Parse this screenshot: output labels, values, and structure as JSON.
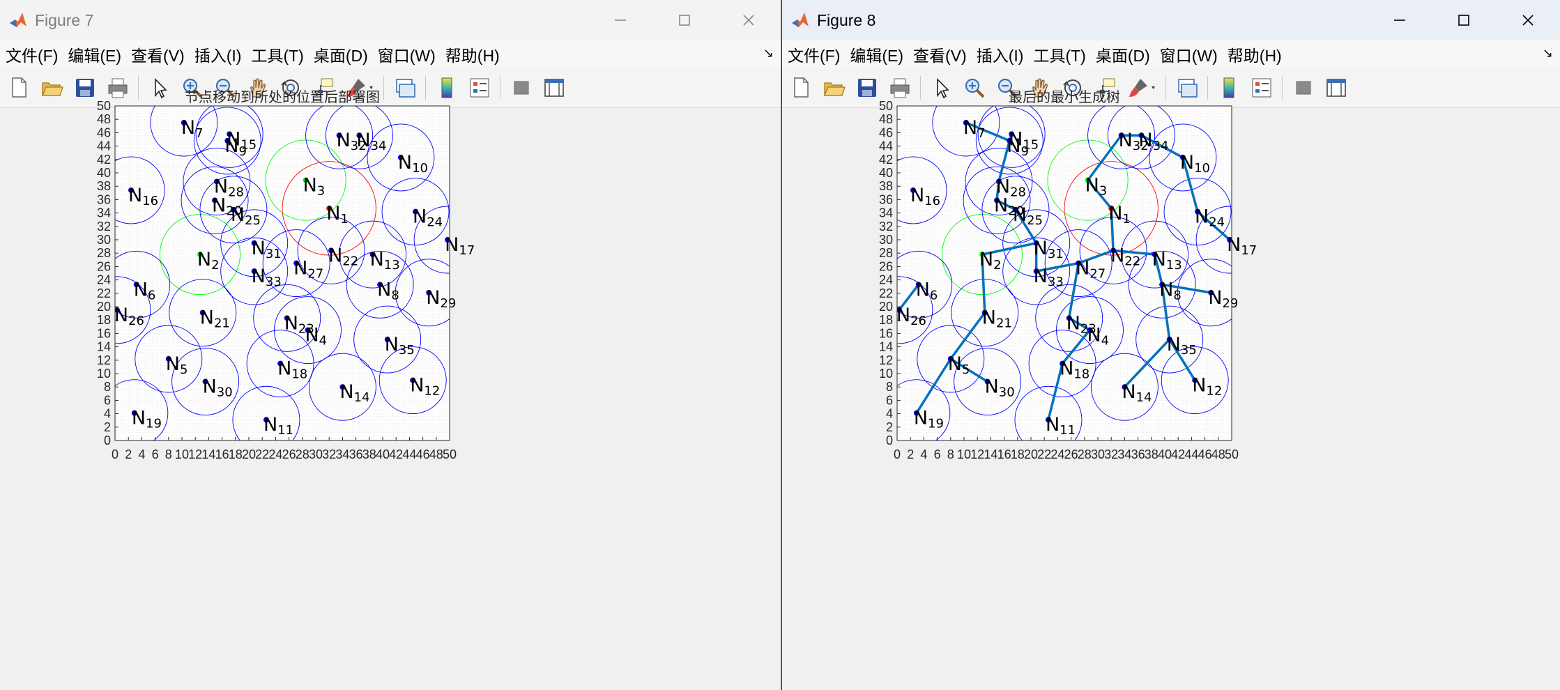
{
  "left_window": {
    "title": "Figure 7",
    "plot_title": "节点移动到所处的位置后部署图",
    "show_mst": false
  },
  "right_window": {
    "title": "Figure 8",
    "plot_title": "最后的最小生成树",
    "show_mst": true
  },
  "menu": [
    "文件(F)",
    "编辑(E)",
    "查看(V)",
    "插入(I)",
    "工具(T)",
    "桌面(D)",
    "窗口(W)",
    "帮助(H)"
  ],
  "menu_overflow": "↘",
  "toolbar_icons": [
    "new-figure-icon",
    "open-file-icon",
    "save-icon",
    "print-icon",
    "pointer-icon",
    "zoom-in-icon",
    "zoom-out-icon",
    "pan-hand-icon",
    "rotate-3d-icon",
    "data-cursor-icon",
    "brush-icon",
    "link-plot-icon",
    "colorbar-icon",
    "legend-icon",
    "hide-plot-tools-icon",
    "show-plot-tools-icon"
  ],
  "colors": {
    "axes_bg": "#ffffff",
    "grid": "#e2e2e2",
    "node": "#0000ff",
    "circle": "#0000ff",
    "sink_node": "#ff0000",
    "special_node": "#00ff00",
    "mst_edge": "#0072bd",
    "node_label": "#000000"
  },
  "chart_data": {
    "type": "scatter",
    "x_ticks": [
      "0",
      "2",
      "4",
      "6",
      "8",
      "10",
      "12",
      "14",
      "16",
      "18",
      "20",
      "22",
      "24",
      "26",
      "28",
      "30",
      "32",
      "34",
      "36",
      "38",
      "40",
      "42",
      "44",
      "46",
      "48",
      "50"
    ],
    "y_ticks": [
      "0",
      "2",
      "4",
      "6",
      "8",
      "10",
      "12",
      "14",
      "16",
      "18",
      "20",
      "22",
      "24",
      "26",
      "28",
      "30",
      "32",
      "34",
      "36",
      "38",
      "40",
      "42",
      "44",
      "46",
      "48",
      "50"
    ],
    "xlim": [
      0,
      50
    ],
    "ylim": [
      0,
      50
    ],
    "grid": "minor",
    "node_letter": "N",
    "coverage_radius": 5,
    "sink_radius": 7,
    "nodes": [
      {
        "id": "1",
        "x": 32.0,
        "y": 34.7,
        "color": "red"
      },
      {
        "id": "2",
        "x": 12.7,
        "y": 27.8,
        "color": "green"
      },
      {
        "id": "3",
        "x": 28.5,
        "y": 38.9,
        "color": "green"
      },
      {
        "id": "4",
        "x": 28.8,
        "y": 16.5
      },
      {
        "id": "5",
        "x": 8.0,
        "y": 12.2
      },
      {
        "id": "6",
        "x": 3.2,
        "y": 23.3
      },
      {
        "id": "7",
        "x": 10.3,
        "y": 47.5
      },
      {
        "id": "8",
        "x": 39.6,
        "y": 23.3
      },
      {
        "id": "9",
        "x": 16.8,
        "y": 44.8
      },
      {
        "id": "10",
        "x": 42.7,
        "y": 42.3
      },
      {
        "id": "11",
        "x": 22.6,
        "y": 3.1
      },
      {
        "id": "12",
        "x": 44.5,
        "y": 9.0
      },
      {
        "id": "13",
        "x": 38.5,
        "y": 27.8
      },
      {
        "id": "14",
        "x": 34.0,
        "y": 8.0
      },
      {
        "id": "15",
        "x": 17.1,
        "y": 45.8
      },
      {
        "id": "16",
        "x": 2.4,
        "y": 37.4
      },
      {
        "id": "17",
        "x": 49.7,
        "y": 30.0
      },
      {
        "id": "18",
        "x": 24.7,
        "y": 11.5
      },
      {
        "id": "19",
        "x": 2.9,
        "y": 4.1
      },
      {
        "id": "20",
        "x": 14.9,
        "y": 35.9
      },
      {
        "id": "21",
        "x": 13.1,
        "y": 19.1
      },
      {
        "id": "22",
        "x": 32.3,
        "y": 28.4
      },
      {
        "id": "23",
        "x": 25.7,
        "y": 18.3
      },
      {
        "id": "24",
        "x": 44.9,
        "y": 34.2
      },
      {
        "id": "25",
        "x": 17.7,
        "y": 34.5
      },
      {
        "id": "26",
        "x": 0.3,
        "y": 19.5
      },
      {
        "id": "27",
        "x": 27.1,
        "y": 26.5
      },
      {
        "id": "28",
        "x": 15.2,
        "y": 38.7
      },
      {
        "id": "29",
        "x": 46.9,
        "y": 22.1
      },
      {
        "id": "30",
        "x": 13.5,
        "y": 8.8
      },
      {
        "id": "31",
        "x": 20.8,
        "y": 29.5
      },
      {
        "id": "32",
        "x": 33.5,
        "y": 45.6
      },
      {
        "id": "33",
        "x": 20.8,
        "y": 25.3
      },
      {
        "id": "34",
        "x": 36.5,
        "y": 45.6
      },
      {
        "id": "35",
        "x": 40.7,
        "y": 15.1
      }
    ],
    "mst_edges": [
      [
        "7",
        "9"
      ],
      [
        "9",
        "15"
      ],
      [
        "9",
        "28"
      ],
      [
        "28",
        "20"
      ],
      [
        "20",
        "25"
      ],
      [
        "25",
        "31"
      ],
      [
        "31",
        "2"
      ],
      [
        "31",
        "33"
      ],
      [
        "2",
        "21"
      ],
      [
        "21",
        "5"
      ],
      [
        "5",
        "30"
      ],
      [
        "5",
        "19"
      ],
      [
        "6",
        "26"
      ],
      [
        "33",
        "27"
      ],
      [
        "27",
        "23"
      ],
      [
        "23",
        "4"
      ],
      [
        "4",
        "18"
      ],
      [
        "18",
        "11"
      ],
      [
        "27",
        "22"
      ],
      [
        "22",
        "1"
      ],
      [
        "1",
        "3"
      ],
      [
        "3",
        "32"
      ],
      [
        "32",
        "34"
      ],
      [
        "34",
        "10"
      ],
      [
        "10",
        "24"
      ],
      [
        "24",
        "17"
      ],
      [
        "22",
        "13"
      ],
      [
        "13",
        "8"
      ],
      [
        "8",
        "29"
      ],
      [
        "8",
        "35"
      ],
      [
        "35",
        "12"
      ],
      [
        "35",
        "14"
      ]
    ]
  }
}
